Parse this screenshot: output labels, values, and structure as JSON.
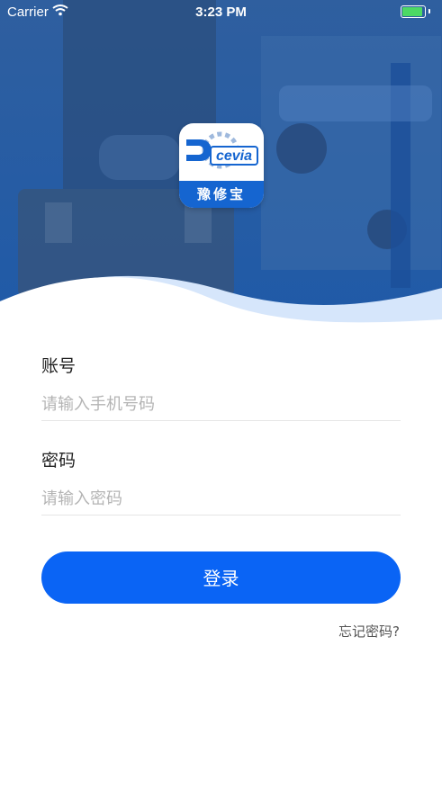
{
  "status_bar": {
    "carrier": "Carrier",
    "time": "3:23 PM",
    "battery_level": 1.0
  },
  "logo": {
    "wordmark": "cevia",
    "name": "豫修宝"
  },
  "form": {
    "account_label": "账号",
    "account_placeholder": "请输入手机号码",
    "password_label": "密码",
    "password_placeholder": "请输入密码"
  },
  "login_button": "登录",
  "forgot_password": "忘记密码?",
  "colors": {
    "primary": "#0a64f5",
    "brand": "#1565d0",
    "hero_overlay": "#1e5fb4"
  }
}
